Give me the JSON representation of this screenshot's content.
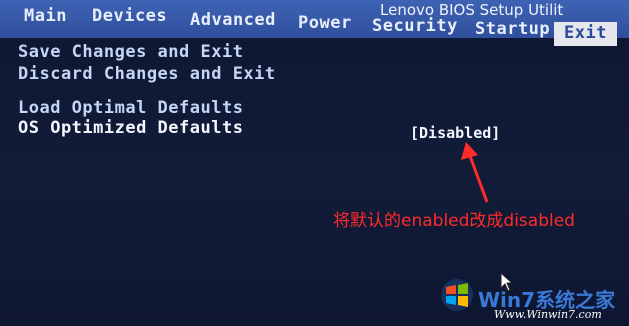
{
  "bios": {
    "vendor_title": "Lenovo BIOS Setup Utilit",
    "tabs": [
      {
        "label": "Main"
      },
      {
        "label": "Devices"
      },
      {
        "label": "Advanced"
      },
      {
        "label": "Power"
      },
      {
        "label": "Security"
      },
      {
        "label": "Startup"
      },
      {
        "label": "Exit"
      }
    ],
    "active_tab": "Exit",
    "menu": {
      "save_changes_exit": "Save Changes and Exit",
      "discard_changes_exit": "Discard Changes and Exit",
      "load_optimal_defaults": "Load Optimal Defaults",
      "os_optimized_defaults": "OS Optimized Defaults"
    },
    "selected_value": "[Disabled]"
  },
  "annotation": {
    "text": "将默认的enabled改成disabled",
    "color": "#ff2a2a"
  },
  "watermark": {
    "brand": "Win7系统之家",
    "url": "Www.Winwin7.com"
  },
  "colors": {
    "menu_bar": "#3a5db0",
    "background": "#111c39",
    "active_tab_bg": "#e5e7ec"
  }
}
